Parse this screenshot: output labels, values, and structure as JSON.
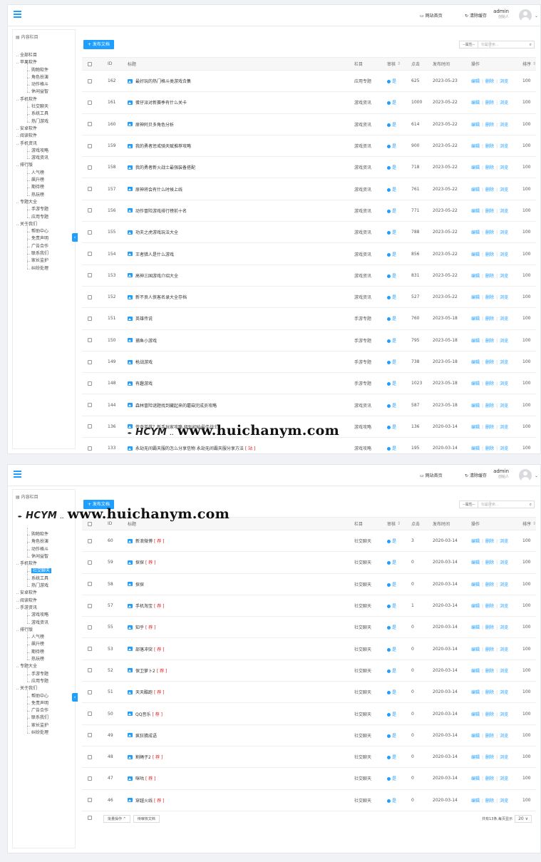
{
  "header": {
    "site_home": "网站首页",
    "clear_cache": "清除缓存",
    "user_name": "admin",
    "user_role": "创始人"
  },
  "sidebar": {
    "title": "内容栏目",
    "tree_a": [
      "全部栏目",
      "苹果软件",
      "购物软件",
      "角色扮演",
      "动作格斗",
      "休闲益智",
      "手机软件",
      "社交聊天",
      "系统工具",
      "热门游戏",
      "安卓软件",
      "阅读软件",
      "手机资讯",
      "游戏攻略",
      "游戏资讯",
      "排行版",
      "人气榜",
      "飙升榜",
      "期待榜",
      "热玩榜",
      "专题大全",
      "手游专题",
      "应用专题",
      "关于我们",
      "帮助中心",
      "免责声明",
      "广告合作",
      "联系我们",
      "家长监护",
      "纠纷处理"
    ],
    "tree_b": [
      "购物软件",
      "角色扮演",
      "动作格斗",
      "休闲益智",
      "手机软件",
      "社交聊天",
      "系统工具",
      "热门游戏",
      "安卓软件",
      "阅读软件",
      "手游资讯",
      "游戏攻略",
      "游戏资讯",
      "排行版",
      "人气榜",
      "飙升榜",
      "期待榜",
      "热玩榜",
      "专题大全",
      "手游专题",
      "应用专题",
      "关于我们",
      "帮助中心",
      "免责声明",
      "广告合作",
      "联系我们",
      "家长监护",
      "纠纷处理"
    ],
    "levels_a": [
      0,
      0,
      1,
      1,
      1,
      1,
      0,
      1,
      1,
      1,
      0,
      0,
      0,
      1,
      1,
      0,
      1,
      1,
      1,
      1,
      0,
      1,
      1,
      0,
      1,
      1,
      1,
      1,
      1,
      1
    ],
    "levels_b": [
      1,
      1,
      1,
      1,
      0,
      1,
      1,
      1,
      0,
      0,
      0,
      1,
      1,
      0,
      1,
      1,
      1,
      1,
      0,
      1,
      1,
      0,
      1,
      1,
      1,
      1,
      1,
      1
    ],
    "selected_b": "社交聊天"
  },
  "toolbar": {
    "publish": "+ 发布文档",
    "attr_select": "--属性--",
    "search_placeholder": "标题搜索..."
  },
  "columns": {
    "id": "ID",
    "title": "标题",
    "column": "栏目",
    "audit": "审核",
    "clicks": "点击",
    "pubtime": "发布时间",
    "ops": "操作",
    "sort": "排序"
  },
  "ops": {
    "edit": "编辑",
    "delete": "删除",
    "view": "浏览"
  },
  "audit_yes": "是",
  "rows_a": [
    {
      "id": "162",
      "title": "最好玩的热门格斗类游戏合集",
      "col": "应用专题",
      "clicks": "625",
      "date": "2023-05-23",
      "sort": "100"
    },
    {
      "id": "161",
      "title": "蛋仔派对新赛季有什么关卡",
      "col": "游戏资讯",
      "clicks": "1000",
      "date": "2023-05-22",
      "sort": "100"
    },
    {
      "id": "160",
      "title": "原神阿贝多角色分析",
      "col": "游戏资讯",
      "clicks": "614",
      "date": "2023-05-22",
      "sort": "100"
    },
    {
      "id": "159",
      "title": "我的勇者惩戒骑天赋推荐攻略",
      "col": "游戏资讯",
      "clicks": "900",
      "date": "2023-05-22",
      "sort": "100"
    },
    {
      "id": "158",
      "title": "我的勇者新火战士最强装备搭配",
      "col": "游戏资讯",
      "clicks": "718",
      "date": "2023-05-22",
      "sort": "100"
    },
    {
      "id": "157",
      "title": "原神将会有什么时候上线",
      "col": "游戏资讯",
      "clicks": "761",
      "date": "2023-05-22",
      "sort": "100"
    },
    {
      "id": "156",
      "title": "动作冒险游戏排行榜前十名",
      "col": "游戏资讯",
      "clicks": "771",
      "date": "2023-05-22",
      "sort": "100"
    },
    {
      "id": "155",
      "title": "功夫之虎游戏玩法大全",
      "col": "游戏资讯",
      "clicks": "788",
      "date": "2023-05-22",
      "sort": "100"
    },
    {
      "id": "154",
      "title": "王者猎人是什么游戏",
      "col": "游戏资讯",
      "clicks": "856",
      "date": "2023-05-22",
      "sort": "100"
    },
    {
      "id": "153",
      "title": "高神三国游戏介绍大全",
      "col": "游戏资讯",
      "clicks": "831",
      "date": "2023-05-22",
      "sort": "100"
    },
    {
      "id": "152",
      "title": "新不良人侠客名录大全存档",
      "col": "游戏资讯",
      "clicks": "527",
      "date": "2023-05-22",
      "sort": "100"
    },
    {
      "id": "151",
      "title": "英雄传说",
      "col": "手游专题",
      "clicks": "760",
      "date": "2023-05-18",
      "sort": "100"
    },
    {
      "id": "150",
      "title": "捕鱼小游戏",
      "col": "手游专题",
      "clicks": "795",
      "date": "2023-05-18",
      "sort": "100"
    },
    {
      "id": "149",
      "title": "枪战游戏",
      "col": "手游专题",
      "clicks": "738",
      "date": "2023-05-18",
      "sort": "100"
    },
    {
      "id": "148",
      "title": "有趣游戏",
      "col": "手游专题",
      "clicks": "1023",
      "date": "2023-05-18",
      "sort": "100"
    },
    {
      "id": "144",
      "title": "森林冒险谜题找到藏起来的蘑菇完成员攻略",
      "col": "游戏资讯",
      "clicks": "587",
      "date": "2023-05-18",
      "sort": "100"
    },
    {
      "id": "136",
      "title": "传奇英雄？新手玩家攻略 级别初始最佳战士",
      "col": "游戏攻略",
      "clicks": "136",
      "date": "2020-03-14",
      "sort": "100"
    },
    {
      "id": "133",
      "title": "永劫无间霸天服的怎么分享信物 永劫无间霸天服分享方法",
      "flag": "[ 站 ]",
      "col": "游戏攻略",
      "clicks": "195",
      "date": "2020-03-14",
      "sort": "100"
    }
  ],
  "rows_b": [
    {
      "id": "60",
      "title": "新浪微博",
      "flag": "[ 荐 ]",
      "col": "社交聊天",
      "clicks": "3",
      "date": "2020-03-14",
      "sort": "100"
    },
    {
      "id": "59",
      "title": "探探",
      "flag": "[ 荐 ]",
      "col": "社交聊天",
      "clicks": "0",
      "date": "2020-03-14",
      "sort": "100"
    },
    {
      "id": "58",
      "title": "探探",
      "col": "社交聊天",
      "clicks": "0",
      "date": "2020-03-14",
      "sort": "100"
    },
    {
      "id": "57",
      "title": "手机淘宝",
      "flag": "[ 荐 ]",
      "col": "社交聊天",
      "clicks": "1",
      "date": "2020-03-14",
      "sort": "100"
    },
    {
      "id": "55",
      "title": "知乎",
      "flag": "[ 荐 ]",
      "col": "社交聊天",
      "clicks": "0",
      "date": "2020-03-14",
      "sort": "100"
    },
    {
      "id": "53",
      "title": "部落冲突",
      "flag": "[ 荐 ]",
      "col": "社交聊天",
      "clicks": "0",
      "date": "2020-03-14",
      "sort": "100"
    },
    {
      "id": "52",
      "title": "保卫萝卜2",
      "flag": "[ 荐 ]",
      "col": "社交聊天",
      "clicks": "0",
      "date": "2020-03-14",
      "sort": "100"
    },
    {
      "id": "51",
      "title": "天天酷跑",
      "flag": "[ 荐 ]",
      "col": "社交聊天",
      "clicks": "0",
      "date": "2020-03-14",
      "sort": "100"
    },
    {
      "id": "50",
      "title": "QQ音乐",
      "flag": "[ 荐 ]",
      "col": "社交聊天",
      "clicks": "0",
      "date": "2020-03-14",
      "sort": "100"
    },
    {
      "id": "49",
      "title": "疯狂猜成语",
      "col": "社交聊天",
      "clicks": "0",
      "date": "2020-03-14",
      "sort": "100"
    },
    {
      "id": "48",
      "title": "割绳子2",
      "flag": "[ 荐 ]",
      "col": "社交聊天",
      "clicks": "0",
      "date": "2020-03-14",
      "sort": "100"
    },
    {
      "id": "47",
      "title": "咪咕",
      "flag": "[ 荐 ]",
      "col": "社交聊天",
      "clicks": "0",
      "date": "2020-03-14",
      "sort": "100"
    },
    {
      "id": "46",
      "title": "穿越火线",
      "flag": "[ 荐 ]",
      "col": "社交聊天",
      "clicks": "0",
      "date": "2020-03-14",
      "sort": "100"
    }
  ],
  "footer": {
    "batch": "批量操作 ^",
    "pending": "待审核文档",
    "total": "共有13条,每页显示",
    "page_size": "20 ∨"
  },
  "watermark": {
    "logo": "HCYM",
    "suffix": "..",
    "url": "www.huichanym.com"
  },
  "colors": {
    "accent": "#1e9fff",
    "flag": "#e02020"
  }
}
